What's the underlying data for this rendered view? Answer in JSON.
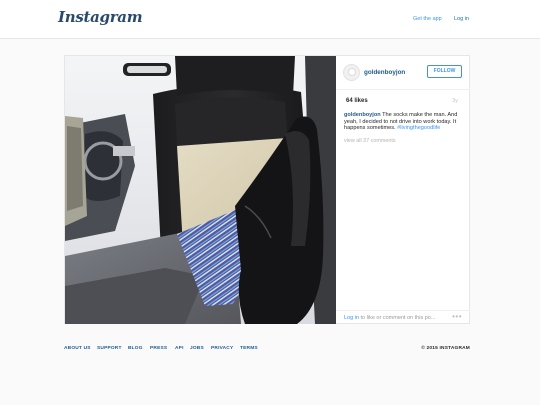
{
  "header": {
    "logo_text": "Instagram",
    "get_app_label": "Get the app",
    "login_label": "Log in"
  },
  "post": {
    "photo_alt": "Leg resting on car seat wearing striped socks and black dress shoe",
    "username": "goldenboyjon",
    "follow_label": "FOLLOW",
    "likes": "64 likes",
    "time_ago": "3y",
    "caption_username": "goldenboyjon",
    "caption_text": " The socks make the man. And yeah, I decided to not drive into work today. It happens sometimes. ",
    "caption_hashtag": "#livingthegoodlife",
    "view_comments": "view all 37 comments",
    "login_link": "Log in",
    "login_prompt_rest": " to like or comment on this po...",
    "more_icon": "more-dots-icon"
  },
  "footer": {
    "links": [
      "ABOUT US",
      "SUPPORT",
      "BLOG",
      "PRESS",
      "API",
      "JOBS",
      "PRIVACY",
      "TERMS"
    ],
    "copyright": "© 2015 INSTAGRAM"
  },
  "colors": {
    "link_blue": "#3897f0",
    "username_blue": "#1d5a8e",
    "background": "#fafafa"
  }
}
